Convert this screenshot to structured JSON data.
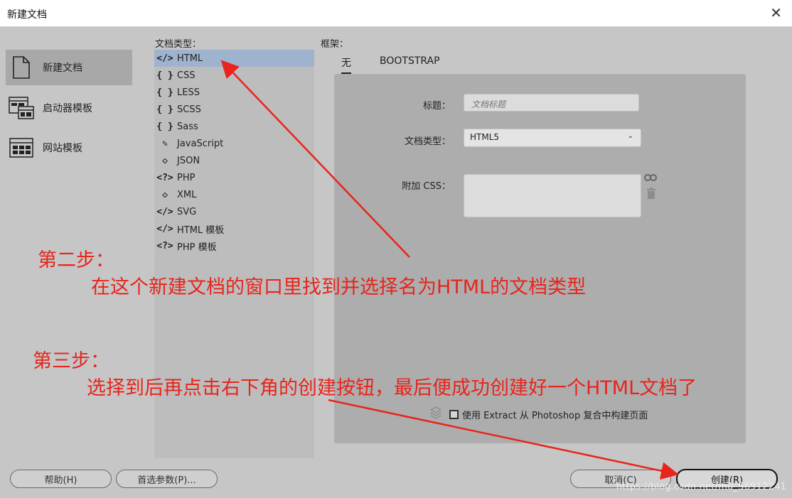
{
  "window": {
    "title": "新建文档",
    "close_glyph": "✕"
  },
  "categories": [
    {
      "label": "新建文档",
      "icon": "new-document-icon",
      "active": true
    },
    {
      "label": "启动器模板",
      "icon": "starter-template-icon",
      "active": false
    },
    {
      "label": "网站模板",
      "icon": "site-template-icon",
      "active": false
    }
  ],
  "doc_type": {
    "label": "文档类型：",
    "items": [
      {
        "icon": "</>",
        "icon_name": "code-tag-icon",
        "label": "HTML",
        "selected": true
      },
      {
        "icon": "{ }",
        "icon_name": "curly-braces-icon",
        "label": "CSS"
      },
      {
        "icon": "{ }",
        "icon_name": "curly-braces-icon",
        "label": "LESS"
      },
      {
        "icon": "{ }",
        "icon_name": "curly-braces-icon",
        "label": "SCSS"
      },
      {
        "icon": "{ }",
        "icon_name": "curly-braces-icon",
        "label": "Sass"
      },
      {
        "icon": "✎",
        "icon_name": "script-scroll-icon",
        "label": "JavaScript"
      },
      {
        "icon": "◇",
        "icon_name": "json-file-icon",
        "label": "JSON"
      },
      {
        "icon": "<?>",
        "icon_name": "php-tag-icon",
        "label": "PHP"
      },
      {
        "icon": "◇",
        "icon_name": "xml-file-icon",
        "label": "XML"
      },
      {
        "icon": "</>",
        "icon_name": "code-tag-icon",
        "label": "SVG"
      },
      {
        "icon": "</>",
        "icon_name": "code-tag-icon",
        "label": "HTML 模板"
      },
      {
        "icon": "<?>",
        "icon_name": "php-tag-icon",
        "label": "PHP 模板"
      }
    ]
  },
  "framework": {
    "label": "框架：",
    "tabs": [
      {
        "label": "无",
        "active": true
      },
      {
        "label": "BOOTSTRAP",
        "active": false
      }
    ]
  },
  "form": {
    "title_label": "标题：",
    "title_placeholder": "文档标题",
    "doctype_label": "文档类型：",
    "doctype_value": "HTML5",
    "attach_css_label": "附加 CSS：",
    "extract_label": "使用 Extract 从 Photoshop 复合中构建页面"
  },
  "buttons": {
    "help": "帮助(H)",
    "preferences": "首选参数(P)...",
    "cancel": "取消(C)",
    "create": "创建(R)"
  },
  "annotations": {
    "step2_title": "第二步：",
    "step2_text": "在这个新建文档的窗口里找到并选择名为HTML的文档类型",
    "step3_title": "第三步：",
    "step3_text": "选择到后再点击右下角的创建按钮，最后便成功创建好一个HTML文档了",
    "color": "#e8241c"
  },
  "watermark": "https://blog.csdn.net/m0_56912241"
}
